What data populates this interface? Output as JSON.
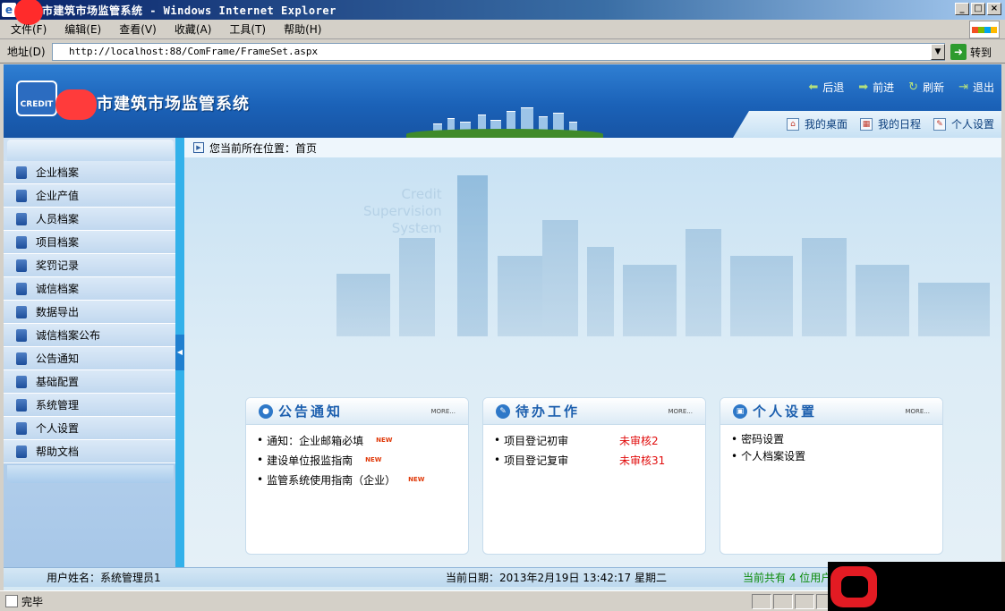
{
  "window": {
    "title": "市建筑市场监管系统 - Windows Internet Explorer",
    "controls": [
      "_",
      "□",
      "×"
    ]
  },
  "menubar": {
    "items": [
      "文件(F)",
      "编辑(E)",
      "查看(V)",
      "收藏(A)",
      "工具(T)",
      "帮助(H)"
    ]
  },
  "address": {
    "label": "地址(D)",
    "url": "http://localhost:88/ComFrame/FrameSet.aspx",
    "go_label": "转到"
  },
  "header": {
    "logo_text": "CREDIT",
    "system_title": "市建筑市场监管系统",
    "topnav": [
      {
        "icon": "back-arrow-icon",
        "label": "后退"
      },
      {
        "icon": "forward-arrow-icon",
        "label": "前进"
      },
      {
        "icon": "refresh-icon",
        "label": "刷新"
      },
      {
        "icon": "exit-icon",
        "label": "退出"
      }
    ],
    "subnav": [
      {
        "icon": "desktop-icon",
        "label": "我的桌面"
      },
      {
        "icon": "calendar-icon",
        "label": "我的日程"
      },
      {
        "icon": "settings-icon",
        "label": "个人设置"
      }
    ]
  },
  "sidebar": {
    "items": [
      "企业档案",
      "企业产值",
      "人员档案",
      "项目档案",
      "奖罚记录",
      "诚信档案",
      "数据导出",
      "诚信档案公布",
      "公告通知",
      "基础配置",
      "系统管理",
      "个人设置",
      "帮助文档"
    ]
  },
  "breadcrumb": "您当前所在位置：首页",
  "watermark": [
    "Credit",
    "Supervision",
    "System"
  ],
  "panels": {
    "notice": {
      "title": "公告通知",
      "more": "MORE...",
      "rows": [
        {
          "text": "通知：企业邮箱必填",
          "badge": "NEW"
        },
        {
          "text": "建设单位报监指南",
          "badge": "NEW"
        },
        {
          "text": "监管系统使用指南（企业）",
          "badge": "NEW"
        }
      ]
    },
    "todo": {
      "title": "待办工作",
      "more": "MORE...",
      "rows": [
        {
          "text": "项目登记初审",
          "status": "未审核2"
        },
        {
          "text": "项目登记复审",
          "status": "未审核31"
        }
      ]
    },
    "personal": {
      "title": "个人设置",
      "more": "MORE...",
      "rows": [
        {
          "text": "密码设置"
        },
        {
          "text": "个人档案设置"
        }
      ]
    }
  },
  "status": {
    "user": "用户姓名：系统管理员1",
    "date": "当前日期：2013年2月19日 13:42:17 星期二",
    "online": "当前共有 4 位用户"
  },
  "ie_status": {
    "text": "完毕"
  },
  "colors": {
    "header_blue": "#1b62b8",
    "splitter": "#33b1ea",
    "panel_title": "#1c5fae",
    "todo_status": "#e10d0d",
    "online_text": "#0a8a0a"
  }
}
